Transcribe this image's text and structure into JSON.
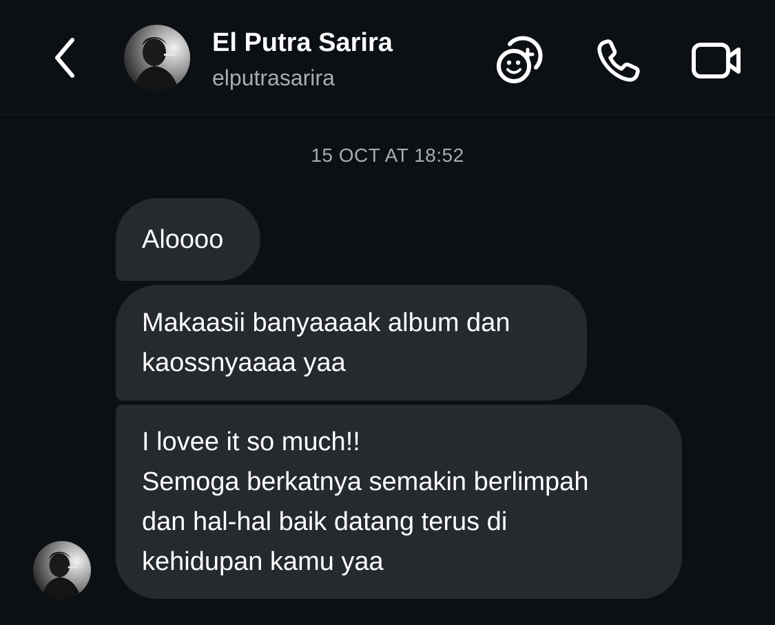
{
  "header": {
    "name": "El Putra Sarira",
    "handle": "elputrasarira",
    "icons": {
      "back": "chevron-left-icon",
      "effects": "emoji-add-icon",
      "call": "phone-icon",
      "video": "video-camera-icon"
    }
  },
  "thread": {
    "timestamp": "15 OCT AT 18:52",
    "messages": [
      {
        "lines": [
          "Aloooo"
        ]
      },
      {
        "lines": [
          "Makaasii banyaaaak album dan",
          "kaossnyaaaa yaa"
        ]
      },
      {
        "lines": [
          "I lovee it so much!!",
          "Semoga berkatnya semakin berlimpah",
          "dan hal-hal baik datang terus di",
          "kehidupan kamu yaa"
        ]
      }
    ]
  },
  "colors": {
    "background": "#0c1014",
    "bubble": "#262a2f",
    "secondary_text": "#a8adb4"
  }
}
